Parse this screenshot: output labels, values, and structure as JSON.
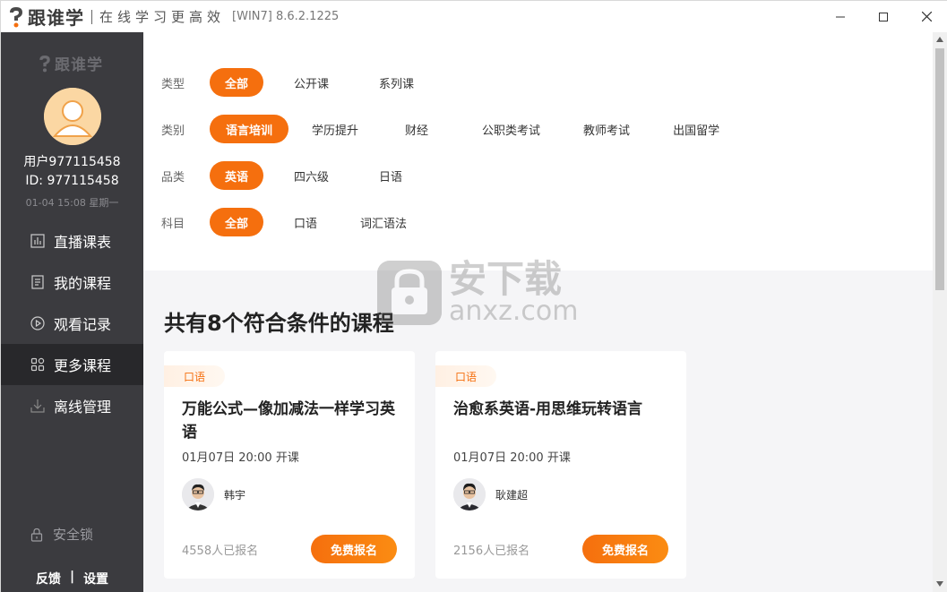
{
  "titlebar": {
    "brand": "跟谁学",
    "slogan": "在线学习更高效",
    "version": "[WIN7] 8.6.2.1225"
  },
  "sidebar": {
    "logo_text": "跟谁学",
    "user_name": "用户977115458",
    "user_id": "ID: 977115458",
    "time": "01-04  15:08  星期一",
    "nav": [
      {
        "label": "直播课表",
        "icon": "chart-icon"
      },
      {
        "label": "我的课程",
        "icon": "document-icon"
      },
      {
        "label": "观看记录",
        "icon": "play-icon"
      },
      {
        "label": "更多课程",
        "icon": "grid-icon",
        "active": true
      },
      {
        "label": "离线管理",
        "icon": "download-icon"
      }
    ],
    "lock_label": "安全锁",
    "feedback": "反馈",
    "divider": "|",
    "settings": "设置"
  },
  "filters": [
    {
      "label": "类型",
      "options": [
        "全部",
        "公开课",
        "系列课"
      ],
      "selected": 0
    },
    {
      "label": "类别",
      "options": [
        "语言培训",
        "学历提升",
        "财经",
        "公职类考试",
        "教师考试",
        "出国留学"
      ],
      "selected": 0
    },
    {
      "label": "品类",
      "options": [
        "英语",
        "四六级",
        "日语"
      ],
      "selected": 0
    },
    {
      "label": "科目",
      "options": [
        "全部",
        "口语",
        "词汇语法"
      ],
      "selected": 0
    }
  ],
  "results": {
    "title": "共有8个符合条件的课程"
  },
  "courses": [
    {
      "tag": "口语",
      "title": "万能公式—像加减法一样学习英语",
      "date": "01月07日 20:00 开课",
      "teacher": "韩宇",
      "count": "4558人已报名",
      "button": "免费报名"
    },
    {
      "tag": "口语",
      "title": "治愈系英语-用思维玩转语言",
      "date": "01月07日 20:00 开课",
      "teacher": "耿建超",
      "count": "2156人已报名",
      "button": "免费报名"
    }
  ],
  "watermark": {
    "cn": "安下载",
    "en": "anxz.com"
  },
  "colors": {
    "accent": "#f56f0e",
    "sidebar": "#3b3b3f",
    "sidebar_active": "#28282b"
  }
}
